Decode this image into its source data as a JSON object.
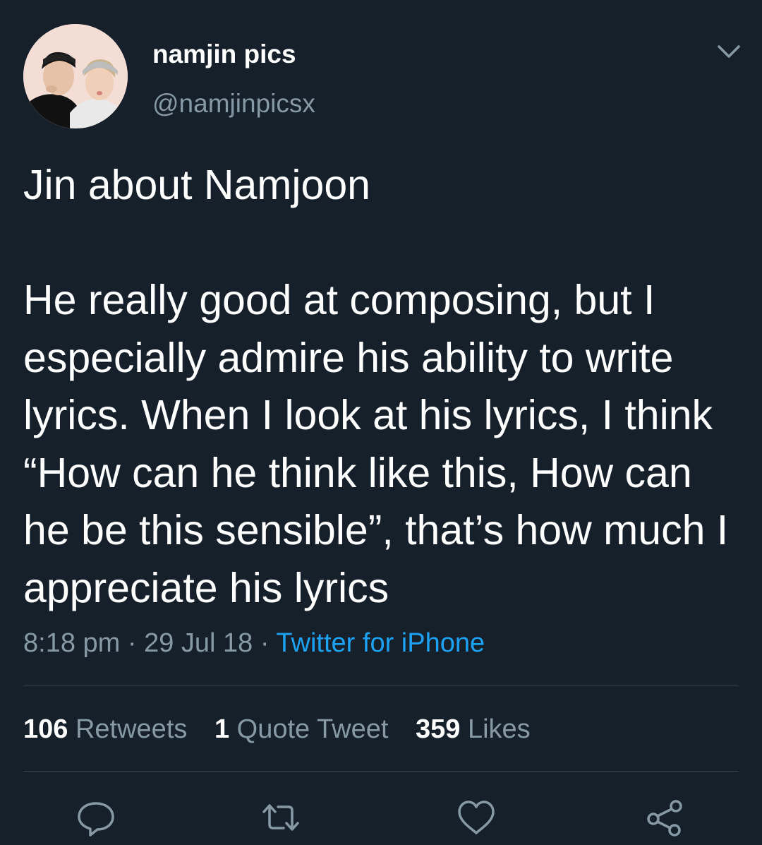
{
  "user": {
    "display_name": "namjin pics",
    "handle": "@namjinpicsx"
  },
  "tweet": {
    "text": "Jin about Namjoon\n\nHe really good at composing, but I especially admire his ability to write lyrics. When I look at his lyrics, I think “How can he think like this, How can he be this sensible”, that’s how much I appreciate his lyrics",
    "time": "8:18 pm",
    "separator": "·",
    "date": "29 Jul 18",
    "source": "Twitter for iPhone"
  },
  "stats": {
    "retweets_count": "106",
    "retweets_label": "Retweets",
    "quotes_count": "1",
    "quotes_label": "Quote Tweet",
    "likes_count": "359",
    "likes_label": "Likes"
  },
  "icons": {
    "menu": "chevron-down-icon",
    "reply": "reply-icon",
    "retweet": "retweet-icon",
    "like": "heart-icon",
    "share": "share-icon"
  },
  "colors": {
    "background": "#15202b",
    "secondary_text": "#8899a6",
    "link": "#1da1f2",
    "divider": "#38444d"
  }
}
